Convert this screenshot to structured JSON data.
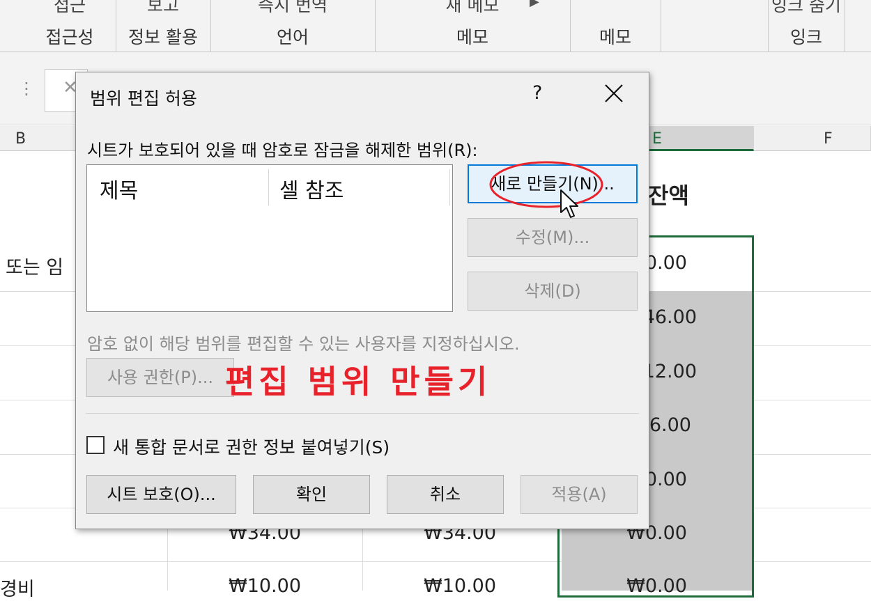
{
  "ribbon": {
    "groups": [
      {
        "top": "접근",
        "label": "접근성"
      },
      {
        "top": "보고",
        "label": "정보 활용"
      },
      {
        "top": "즉시 번역",
        "label": "언어"
      },
      {
        "top": "새 메모",
        "label": "메모"
      },
      {
        "top": "",
        "label": "메모"
      },
      {
        "top": "",
        "label": ""
      },
      {
        "top": "잉크 숨기",
        "label": "잉크"
      }
    ]
  },
  "columns": {
    "b": "B",
    "e": "E",
    "f": "F"
  },
  "sheet": {
    "heading_partial": "잔액",
    "row_label_1": "또는 임",
    "row_label_2": "경비",
    "e_values": [
      "₩0.00",
      "₩46.00",
      "₩12.00",
      "₩6.00",
      "₩0.00",
      "₩0.00",
      "₩0.00"
    ],
    "c_value_1": "₩34.00",
    "d_value_1": "₩34.00",
    "c_value_2": "₩10.00",
    "d_value_2": "₩10.00"
  },
  "dialog": {
    "title": "범위 편집 허용",
    "help": "?",
    "ranges_label": "시트가 보호되어 있을 때 암호로 잠금을 해제한 범위(R):",
    "list_headers": [
      "제목",
      "셀 참조"
    ],
    "buttons": {
      "new": "새로 만들기(N)...",
      "modify": "수정(M)...",
      "delete": "삭제(D)",
      "permissions": "사용 권한(P)...",
      "protect_sheet": "시트 보호(O)...",
      "ok": "확인",
      "cancel": "취소",
      "apply": "적용(A)"
    },
    "permissions_text": "암호 없이 해당 범위를 편집할 수 있는 사용자를 지정하십시오.",
    "checkbox_label": "새 통합 문서로 권한 정보 붙여넣기(S)",
    "checkbox_checked": false
  },
  "annotation": {
    "text": "편집 범위 만들기",
    "color": "#e8222b"
  },
  "colors": {
    "accent_green": "#1d6b3a",
    "focus_blue": "#0078d7",
    "selection_gray": "#c9c9c9"
  }
}
